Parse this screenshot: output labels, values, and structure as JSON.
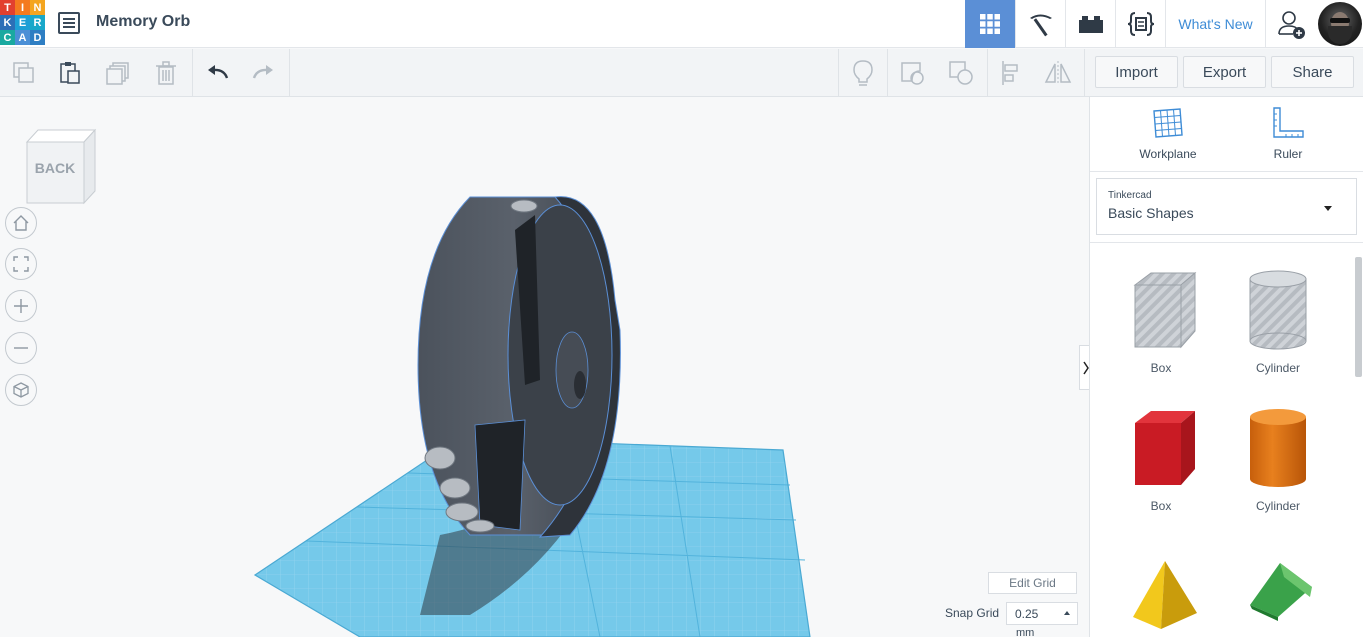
{
  "app": {
    "logo_letters": [
      "T",
      "I",
      "N",
      "K",
      "E",
      "R",
      "C",
      "A",
      "D"
    ],
    "design_title": "Memory Orb"
  },
  "header": {
    "whats_new": "What's New",
    "active_view": "3d-design-view",
    "accent_color": "#5b8fd6"
  },
  "toolbar": {
    "import_label": "Import",
    "export_label": "Export",
    "share_label": "Share"
  },
  "viewcube": {
    "face_label": "BACK"
  },
  "viewport": {
    "edit_grid_label": "Edit Grid",
    "snap_grid_label": "Snap Grid",
    "snap_grid_value": "0.25",
    "snap_grid_unit": "mm",
    "workplane_color": "#6cc4e6",
    "model_color": "#3f4550"
  },
  "panel": {
    "workplane_label": "Workplane",
    "ruler_label": "Ruler",
    "library_provider": "Tinkercad",
    "library_name": "Basic Shapes",
    "shapes": [
      {
        "label": "Box",
        "style": "hole",
        "color": "#b9bec4"
      },
      {
        "label": "Cylinder",
        "style": "hole",
        "color": "#b9bec4"
      },
      {
        "label": "Box",
        "style": "solid",
        "color": "#d4202a"
      },
      {
        "label": "Cylinder",
        "style": "solid",
        "color": "#e8801e"
      },
      {
        "label": "",
        "style": "solid",
        "color": "#f2c81c"
      },
      {
        "label": "",
        "style": "solid",
        "color": "#3aa24a"
      }
    ]
  }
}
